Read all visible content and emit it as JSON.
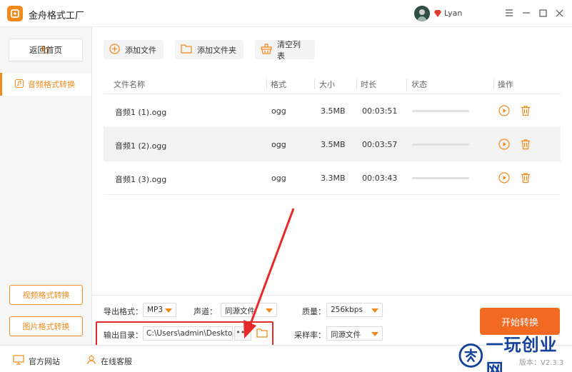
{
  "app": {
    "title": "金舟格式工厂",
    "username": "Lyan",
    "accent": "#f08a1c",
    "brand_orange": "#f26a21"
  },
  "sidebar": {
    "home_label": "返回首页",
    "active_item": "音频格式转换",
    "bottom_items": [
      "视频格式转换",
      "图片格式转换"
    ]
  },
  "toolbar": {
    "add_file": "添加文件",
    "add_folder": "添加文件夹",
    "clear_list": "清空列表"
  },
  "table": {
    "headers": {
      "name": "文件名称",
      "format": "格式",
      "size": "大小",
      "duration": "时长",
      "status": "状态",
      "actions": "操作"
    },
    "rows": [
      {
        "name": "音频1 (1).ogg",
        "format": "ogg",
        "size": "3.5MB",
        "duration": "00:03:51",
        "progress": 0
      },
      {
        "name": "音频1 (2).ogg",
        "format": "ogg",
        "size": "3.5MB",
        "duration": "00:03:57",
        "progress": 0
      },
      {
        "name": "音频1 (3).ogg",
        "format": "ogg",
        "size": "3.3MB",
        "duration": "00:03:43",
        "progress": 0
      }
    ]
  },
  "settings": {
    "export_format_label": "导出格式：",
    "export_format_value": "MP3",
    "channel_label": "声道：",
    "channel_value": "同源文件",
    "quality_label": "质量：",
    "quality_value": "256kbps",
    "output_dir_label": "输出目录：",
    "output_dir_value": "C:\\Users\\admin\\Desktop\\",
    "browse_label": "•••",
    "sample_rate_label": "采样率：",
    "sample_rate_value": "同源文件",
    "start_label": "开始转换"
  },
  "footer": {
    "official_site": "官方网站",
    "online_service": "在线客服",
    "version": "版本：V2.3.3"
  },
  "watermark": {
    "text": "一玩创业网"
  },
  "icons": [
    "app-logo-icon",
    "vip-diamond-icon",
    "menu-icon",
    "minimize-icon",
    "maximize-icon",
    "close-icon",
    "back-icon",
    "audio-icon",
    "add-icon",
    "folder-icon",
    "basket-icon",
    "play-icon",
    "trash-icon",
    "monitor-icon",
    "person-icon"
  ]
}
